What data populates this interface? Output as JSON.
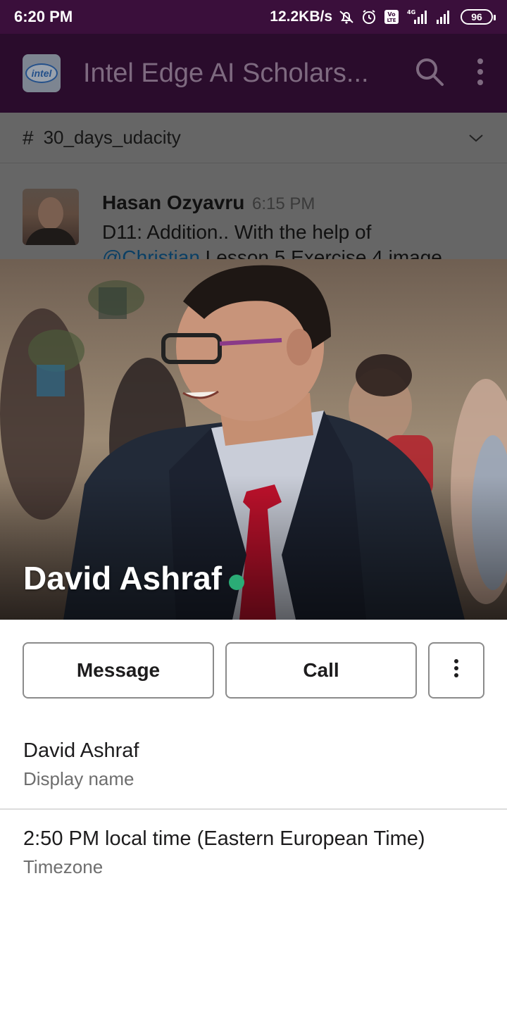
{
  "status_bar": {
    "time": "6:20 PM",
    "network_speed": "12.2KB/s",
    "icons": [
      "mute-bell-icon",
      "alarm-icon",
      "volte-icon",
      "signal-4g-icon",
      "signal-icon"
    ],
    "volte_label": "Vo LTE",
    "network_type": "4G",
    "battery_level": "96"
  },
  "app_bar": {
    "workspace_logo_text": "intel",
    "title": "Intel Edge AI Scholars...",
    "search_icon": "search-icon",
    "overflow_icon": "more-vert-icon"
  },
  "channel": {
    "hash": "#",
    "name": "30_days_udacity",
    "chevron_icon": "chevron-down-icon"
  },
  "message": {
    "sender": "Hasan Ozyavru",
    "time": "6:15 PM",
    "text_line1": "D11: Addition.. With the help of",
    "mention": "@Christian",
    "text_line2_rest": " Lesson 5 Exercise 4 image"
  },
  "profile": {
    "name": "David Ashraf",
    "presence": "active",
    "presence_color": "#2bac76",
    "buttons": {
      "message": "Message",
      "call": "Call",
      "more_icon": "more-vert-icon"
    },
    "fields": [
      {
        "value": "David Ashraf",
        "label": "Display name"
      },
      {
        "value": "2:50 PM local time (Eastern European Time)",
        "label": "Timezone"
      }
    ]
  },
  "colors": {
    "status_bar_bg": "#3a0f3b",
    "app_bar_bg": "#2a0c2c",
    "dim_overlay": "#666666",
    "presence_active": "#2bac76"
  }
}
